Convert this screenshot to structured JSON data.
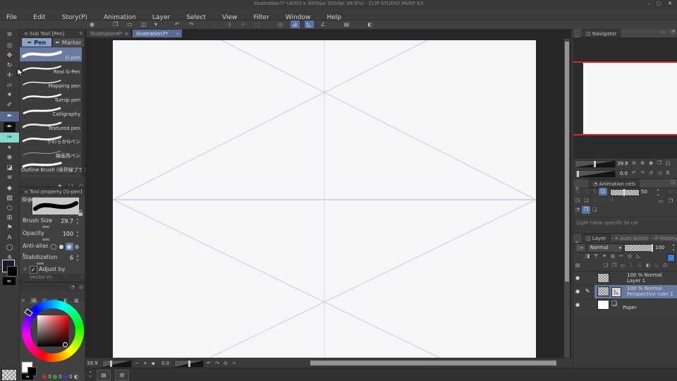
{
  "window": {
    "title": "Illustration7* (4000 x 3000px 300dpi 39.9%)  - CLIP STUDIO PAINT EX",
    "minimize": "–",
    "maximize": "▢",
    "close": "✕"
  },
  "menu": {
    "items": [
      "File",
      "Edit",
      "Story(P)",
      "Animation",
      "Layer",
      "Select",
      "View",
      "Filter",
      "Window",
      "Help"
    ]
  },
  "command_bar": {
    "icons": [
      {
        "name": "app-settings",
        "glyph": "◉"
      },
      {
        "name": "new-file",
        "glyph": "❐"
      },
      {
        "name": "open-file",
        "glyph": "▭"
      },
      {
        "name": "save",
        "glyph": "◫"
      },
      {
        "name": "save-dropdown",
        "glyph": "▾"
      },
      {
        "name": "undo",
        "glyph": "↶"
      },
      {
        "name": "redo",
        "glyph": "↷"
      },
      {
        "name": "deselect",
        "glyph": "◌"
      },
      {
        "name": "invert-selection",
        "glyph": "◑"
      },
      {
        "name": "expand-selection",
        "glyph": "✣"
      },
      {
        "name": "selection-border",
        "glyph": "▢"
      },
      {
        "name": "snap-to-grid",
        "glyph": "▦"
      },
      {
        "name": "snap-to-ruler",
        "glyph": "⊿"
      },
      {
        "name": "snap-to-special-ruler",
        "glyph": "◺"
      },
      {
        "name": "snap-to-guide",
        "glyph": "∠"
      },
      {
        "name": "material-panel",
        "glyph": "▤"
      },
      {
        "name": "screen-mode",
        "glyph": "◐"
      }
    ]
  },
  "doc_tabs": [
    {
      "label": "Illustration6*",
      "close": "✕"
    },
    {
      "label": "Illustration7*",
      "close": "✕"
    }
  ],
  "tools": [
    {
      "name": "main-menu",
      "glyph": "≡"
    },
    {
      "name": "zoom",
      "glyph": "◎"
    },
    {
      "name": "hand",
      "glyph": "✥"
    },
    {
      "name": "rotate",
      "glyph": "↻"
    },
    {
      "name": "move",
      "glyph": "✛"
    },
    {
      "name": "selection",
      "glyph": "▱"
    },
    {
      "name": "auto-select",
      "glyph": "✷"
    },
    {
      "name": "eyedropper",
      "glyph": "✐"
    },
    {
      "name": "pen",
      "glyph": "✒"
    },
    {
      "name": "marker-pen",
      "glyph": "✒"
    },
    {
      "name": "brush",
      "glyph": "✑"
    },
    {
      "name": "airbrush",
      "glyph": "✴"
    },
    {
      "name": "decoration",
      "glyph": "❋"
    },
    {
      "name": "eraser",
      "glyph": "◪"
    },
    {
      "name": "blend",
      "glyph": "≋"
    },
    {
      "name": "fill",
      "glyph": "◆"
    },
    {
      "name": "gradient",
      "glyph": "▨"
    },
    {
      "name": "figure",
      "glyph": "○"
    },
    {
      "name": "frame-border",
      "glyph": "⊞"
    },
    {
      "name": "ruler",
      "glyph": "⚑"
    },
    {
      "name": "text",
      "glyph": "A"
    },
    {
      "name": "balloon",
      "glyph": "◯"
    },
    {
      "name": "flow-line",
      "glyph": "⋔"
    }
  ],
  "subtool": {
    "header": "Sub Tool [Pen]",
    "tabs": [
      {
        "label": "Pen"
      },
      {
        "label": "Marker"
      }
    ],
    "brushes": [
      "G-pen",
      "Real G-Pen",
      "Mapping pen",
      "Turnip pen",
      "Calligraphy",
      "Textured pen",
      "やわらかGペン",
      "線画用ペン",
      "Outline Brush (境界線ブラシ)"
    ],
    "footer_icons": [
      {
        "name": "add-subtool",
        "glyph": "✚"
      },
      {
        "name": "duplicate-subtool",
        "glyph": "❏"
      },
      {
        "name": "delete-subtool",
        "glyph": "♺"
      }
    ]
  },
  "tool_property": {
    "header": "Tool property [G-pen]",
    "tool_name": "G-pen",
    "brush_size_label": "Brush Size",
    "brush_size": "29.7",
    "opacity_label": "Opacity",
    "opacity": "100",
    "antialias_label": "Anti-aliasing",
    "stabilization_label": "Stabilization",
    "stabilization": "6",
    "adjust_by_speed": "Adjust by speed",
    "footer": "Vector m"
  },
  "color_panel": {
    "header_icons": [
      {
        "name": "color-history",
        "glyph": "◔"
      },
      {
        "name": "color-picker",
        "glyph": "◎"
      }
    ],
    "type_icons": [
      {
        "name": "panel-menu",
        "glyph": "≡"
      },
      {
        "name": "color-wheel",
        "glyph": "◉"
      },
      {
        "name": "color-sliders",
        "glyph": "▤"
      },
      {
        "name": "color-set",
        "glyph": "◫"
      },
      {
        "name": "mixing-palette",
        "glyph": "◧"
      },
      {
        "name": "intermediate-color",
        "glyph": "▩"
      }
    ],
    "rgb": [
      {
        "name": "red",
        "color": "#c03030",
        "value": "0"
      },
      {
        "name": "green",
        "color": "#2fa32f",
        "value": "0"
      },
      {
        "name": "blue",
        "color": "#3040c0",
        "value": "0"
      }
    ],
    "grayscale_icon": "◐",
    "transparent_glyph": "≈"
  },
  "navigator": {
    "header": "Navigator",
    "header_icons": [
      {
        "name": "subview",
        "glyph": "▭"
      },
      {
        "name": "panel-info",
        "glyph": "◔"
      }
    ],
    "zoom": "39.9",
    "rotation": "0.0",
    "zoom_icons": [
      {
        "name": "zoom-out",
        "glyph": "⊖"
      },
      {
        "name": "zoom-in",
        "glyph": "⊕"
      },
      {
        "name": "zoom-100",
        "glyph": "◉"
      },
      {
        "name": "fit-to-screen",
        "glyph": "❐"
      },
      {
        "name": "fit-to-width",
        "glyph": "◰"
      }
    ],
    "rotate_icons": [
      {
        "name": "rotate-left",
        "glyph": "↶"
      },
      {
        "name": "rotate-right",
        "glyph": "↷"
      },
      {
        "name": "reset-rotation",
        "glyph": "↺"
      },
      {
        "name": "flip-horizontal",
        "glyph": "◁"
      },
      {
        "name": "flip-vertical",
        "glyph": "⇅"
      }
    ]
  },
  "animation": {
    "header": "Animation cels",
    "opacity": "50",
    "hint": "Light table specific to cel",
    "icons_row1": [
      {
        "name": "playback",
        "glyph": "⊙"
      },
      {
        "name": "flip-cel",
        "glyph": "◁"
      },
      {
        "name": "onion-skin",
        "glyph": "⇅"
      },
      {
        "name": "light-table-toggle",
        "glyph": "◫"
      }
    ],
    "folder_icon": "▭",
    "icons_row2": [
      {
        "name": "register-cel",
        "glyph": "◳"
      },
      {
        "name": "new-animation-cel",
        "glyph": "❏"
      },
      {
        "name": "prev-cel",
        "glyph": "‹"
      },
      {
        "name": "next-cel",
        "glyph": "›"
      },
      {
        "name": "replay",
        "glyph": "↺"
      }
    ],
    "icons_row2b": [
      {
        "name": "open-cel-folder",
        "glyph": "▭"
      },
      {
        "name": "duplicate-cel",
        "glyph": "❐"
      }
    ],
    "icons_row3": [
      {
        "name": "edit-target-cel",
        "glyph": "◔"
      },
      {
        "name": "light-table-cel",
        "glyph": "❐"
      },
      {
        "name": "copy-cel",
        "glyph": "❏"
      }
    ]
  },
  "layer_panel": {
    "tabs": [
      {
        "label": "Layer",
        "icon": "◫"
      },
      {
        "label": "Auto Action",
        "icon": "✦"
      },
      {
        "label": "History",
        "icon": "↺"
      }
    ],
    "blend_mode": "Normal",
    "opacity": "100",
    "icons_row_a": [
      {
        "name": "clip-to-layer-below",
        "glyph": "◨"
      },
      {
        "name": "lock-transparent-pixels",
        "glyph": "〒"
      },
      {
        "name": "lock-layer",
        "glyph": "✦"
      },
      {
        "name": "enable-mask",
        "glyph": "◍"
      },
      {
        "name": "set-as-draft",
        "glyph": "✂"
      },
      {
        "name": "search-layer",
        "glyph": "◎"
      },
      {
        "name": "ruler-range",
        "glyph": "◺"
      },
      {
        "name": "layer-color-dropdown",
        "glyph": "▾"
      }
    ],
    "icons_row_b": [
      {
        "name": "panel-list-mode",
        "glyph": "▤"
      },
      {
        "name": "new-raster-layer",
        "glyph": "❏"
      },
      {
        "name": "new-vector-layer",
        "glyph": "❐"
      },
      {
        "name": "new-layer-folder",
        "glyph": "▭"
      },
      {
        "name": "transfer-to-lower",
        "glyph": "⇩"
      },
      {
        "name": "combine-to-lower",
        "glyph": "⇊"
      },
      {
        "name": "create-mask",
        "glyph": "◐"
      },
      {
        "name": "apply-mask",
        "glyph": "⊡"
      },
      {
        "name": "delete-layer",
        "glyph": "♺"
      }
    ],
    "layers": [
      {
        "info": "100 % Normal",
        "name": "Layer 1"
      },
      {
        "info": "100 % Normal",
        "name": "Perspective ruler 1"
      },
      {
        "info": "",
        "name": "Paper"
      }
    ],
    "ruler_badge": "◺",
    "edit_pen": "✎",
    "eye": "●"
  },
  "canvas_status": {
    "zoom": "39.9",
    "rotation": "0.0",
    "icons": [
      {
        "name": "zoom-out",
        "glyph": "−"
      },
      {
        "name": "zoom-in",
        "glyph": "+"
      },
      {
        "name": "fit",
        "glyph": "▪"
      },
      {
        "name": "rotate-left",
        "glyph": "↶"
      },
      {
        "name": "rotate-right",
        "glyph": "↷"
      },
      {
        "name": "reset-view",
        "glyph": "⊙"
      },
      {
        "name": "clear-rotation",
        "glyph": "✕"
      }
    ]
  },
  "bottom_bar": {
    "buttons": [
      {
        "name": "palette-dock-1",
        "glyph": "▤"
      },
      {
        "name": "palette-dock-2",
        "glyph": "⊞"
      }
    ]
  }
}
